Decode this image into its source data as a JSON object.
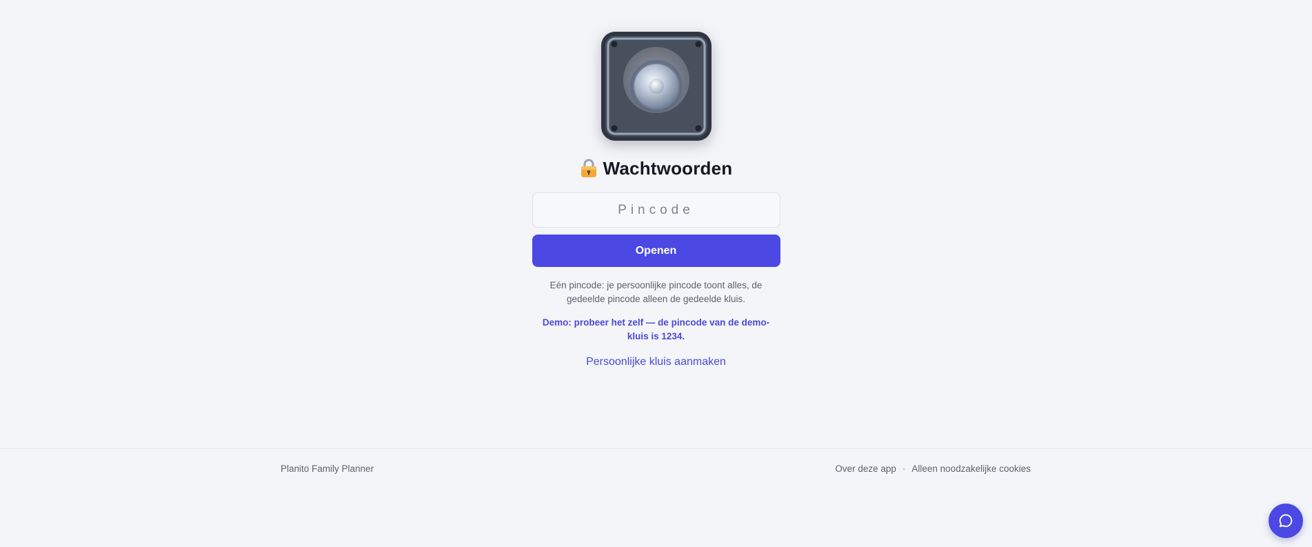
{
  "app": {
    "title": "Wachtwoorden",
    "lock_emoji": "🔒"
  },
  "form": {
    "pin_placeholder": "Pincode",
    "pin_value": "",
    "open_label": "Openen"
  },
  "info": {
    "text": "Eén pincode: je persoonlijke pincode toont alles, de gedeelde pincode alleen de gedeelde kluis.",
    "demo": "Demo: probeer het zelf — de pincode van de demo-kluis is 1234."
  },
  "links": {
    "create_personal_vault": "Persoonlijke kluis aanmaken"
  },
  "footer": {
    "brand": "Planito Family Planner",
    "about": "Over deze app",
    "separator": "·",
    "cookies": "Alleen noodzakelijke cookies"
  },
  "icons": {
    "vault": "vault-icon",
    "lock": "lock-icon",
    "chat": "chat-bubble-icon"
  },
  "colors": {
    "accent": "#4b48e3",
    "background": "#f4f5f9",
    "vault_body": "#48505d"
  }
}
